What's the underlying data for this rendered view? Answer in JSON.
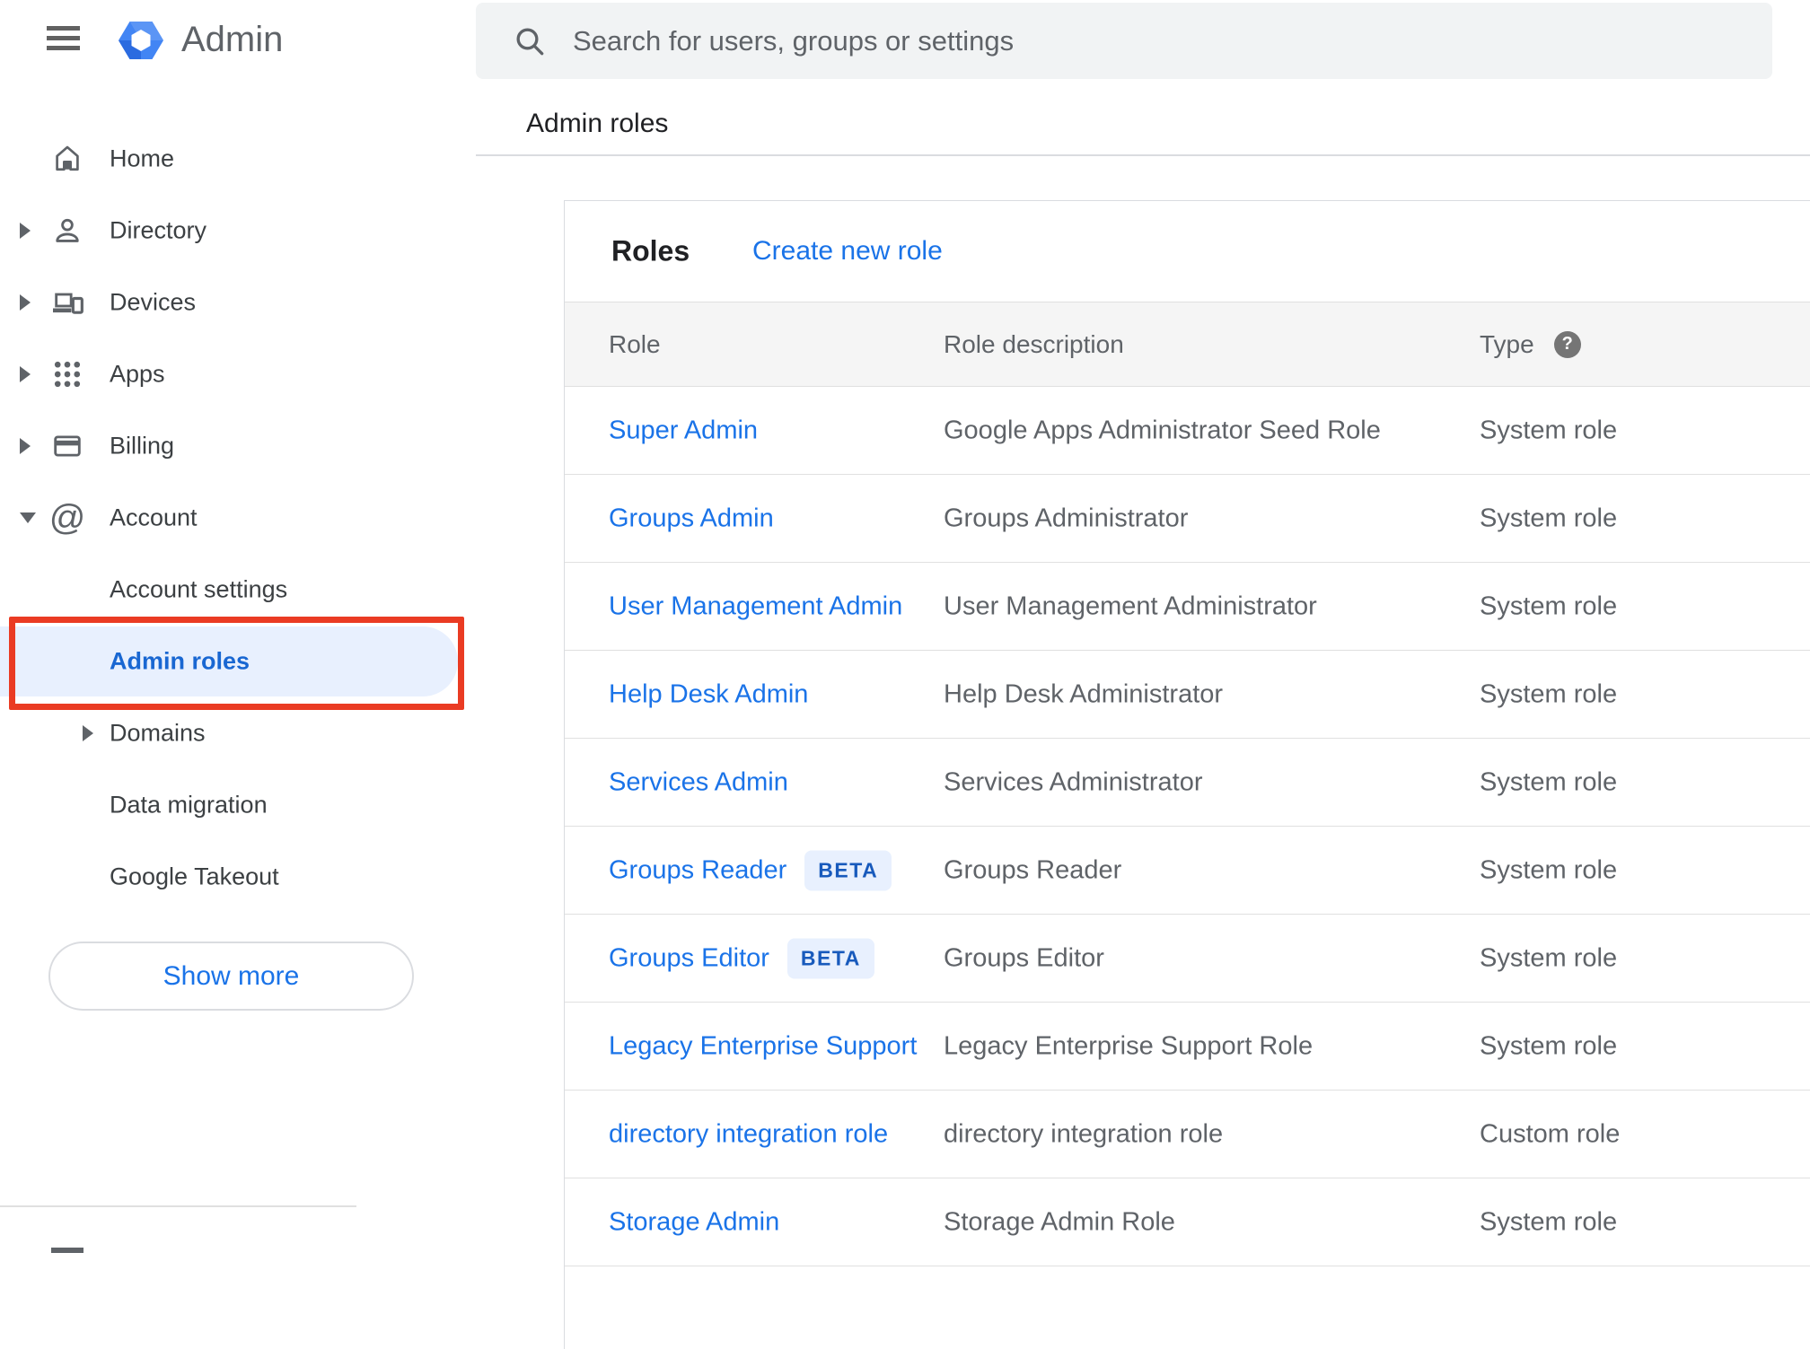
{
  "app": {
    "title": "Admin"
  },
  "search": {
    "placeholder": "Search for users, groups or settings"
  },
  "breadcrumb": "Admin roles",
  "icons": {
    "at_glyph": "@",
    "help_glyph": "?"
  },
  "sidebar": {
    "items": [
      {
        "label": "Home",
        "icon": "home",
        "arrow": "none",
        "indent": false,
        "selected": false
      },
      {
        "label": "Directory",
        "icon": "person",
        "arrow": "right",
        "indent": false,
        "selected": false
      },
      {
        "label": "Devices",
        "icon": "devices",
        "arrow": "right",
        "indent": false,
        "selected": false
      },
      {
        "label": "Apps",
        "icon": "apps",
        "arrow": "right",
        "indent": false,
        "selected": false
      },
      {
        "label": "Billing",
        "icon": "billing",
        "arrow": "right",
        "indent": false,
        "selected": false
      },
      {
        "label": "Account",
        "icon": "at",
        "arrow": "down",
        "indent": false,
        "selected": false
      },
      {
        "label": "Account settings",
        "icon": "",
        "arrow": "none",
        "indent": true,
        "selected": false
      },
      {
        "label": "Admin roles",
        "icon": "",
        "arrow": "none",
        "indent": true,
        "selected": true
      },
      {
        "label": "Domains",
        "icon": "",
        "arrow": "right",
        "indent": true,
        "selected": false
      },
      {
        "label": "Data migration",
        "icon": "",
        "arrow": "none",
        "indent": true,
        "selected": false
      },
      {
        "label": "Google Takeout",
        "icon": "",
        "arrow": "none",
        "indent": true,
        "selected": false
      }
    ],
    "show_more_label": "Show more"
  },
  "roles_panel": {
    "title": "Roles",
    "create_link": "Create new role",
    "beta_label": "BETA",
    "columns": {
      "role": "Role",
      "description": "Role description",
      "type": "Type"
    },
    "rows": [
      {
        "role": "Super Admin",
        "beta": false,
        "description": "Google Apps Administrator Seed Role",
        "type": "System role"
      },
      {
        "role": "Groups Admin",
        "beta": false,
        "description": "Groups Administrator",
        "type": "System role"
      },
      {
        "role": "User Management Admin",
        "beta": false,
        "description": "User Management Administrator",
        "type": "System role"
      },
      {
        "role": "Help Desk Admin",
        "beta": false,
        "description": "Help Desk Administrator",
        "type": "System role"
      },
      {
        "role": "Services Admin",
        "beta": false,
        "description": "Services Administrator",
        "type": "System role"
      },
      {
        "role": "Groups Reader",
        "beta": true,
        "description": "Groups Reader",
        "type": "System role"
      },
      {
        "role": "Groups Editor",
        "beta": true,
        "description": "Groups Editor",
        "type": "System role"
      },
      {
        "role": "Legacy Enterprise Support",
        "beta": false,
        "description": "Legacy Enterprise Support Role",
        "type": "System role"
      },
      {
        "role": "directory integration role",
        "beta": false,
        "description": "directory integration role",
        "type": "Custom role"
      },
      {
        "role": "Storage Admin",
        "beta": false,
        "description": "Storage Admin Role",
        "type": "System role"
      }
    ]
  },
  "colors": {
    "accent_blue": "#1a73e8",
    "selected_nav_blue": "#1967d2",
    "badge_text_blue": "#185abc",
    "badge_bg": "#e8f0fe",
    "selected_pill_bg": "#e8f0fe",
    "annotation_red": "#ea3b23",
    "search_bg": "#f1f3f4",
    "table_header_bg": "#f5f5f5",
    "icon_gray": "#5f6368"
  }
}
